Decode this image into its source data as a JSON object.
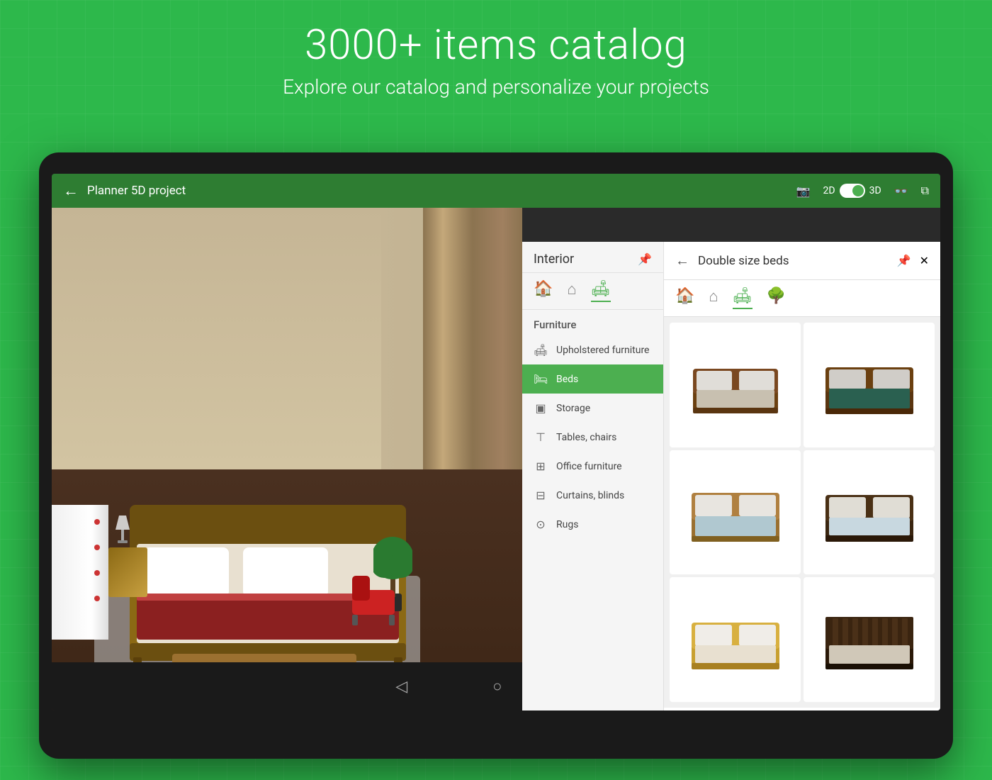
{
  "background_color": "#2db84b",
  "header": {
    "title": "3000+ items catalog",
    "subtitle": "Explore our catalog and personalize your projects"
  },
  "top_bar": {
    "back_label": "←",
    "project_title": "Planner 5D project",
    "view_2d": "2D",
    "view_3d": "3D"
  },
  "interior_panel": {
    "title": "Interior",
    "sections": [
      {
        "label": "Furniture",
        "items": [
          {
            "id": "upholstered",
            "label": "Upholstered furniture",
            "icon": "🛋"
          },
          {
            "id": "beds",
            "label": "Beds",
            "icon": "🛏",
            "active": true
          },
          {
            "id": "storage",
            "label": "Storage",
            "icon": "▣"
          },
          {
            "id": "tables-chairs",
            "label": "Tables, chairs",
            "icon": "⊤"
          },
          {
            "id": "office",
            "label": "Office furniture",
            "icon": "⊞"
          },
          {
            "id": "curtains",
            "label": "Curtains, blinds",
            "icon": "⊟"
          },
          {
            "id": "rugs",
            "label": "Rugs",
            "icon": "⊙"
          }
        ]
      }
    ],
    "tab_icons": [
      "🏠",
      "⌂",
      "🛋"
    ]
  },
  "beds_panel": {
    "title": "Double size\nbeds",
    "back_label": "←",
    "pin_label": "📌",
    "close_label": "✕",
    "tab_icons": [
      "🏠",
      "⌂",
      "🛋",
      "🌳"
    ],
    "beds": [
      {
        "id": "bed1",
        "color_scheme": "brown-white"
      },
      {
        "id": "bed2",
        "color_scheme": "brown-teal"
      },
      {
        "id": "bed3",
        "color_scheme": "light-brown-blue"
      },
      {
        "id": "bed4",
        "color_scheme": "dark-brown-light"
      },
      {
        "id": "bed5",
        "color_scheme": "tan-yellow"
      },
      {
        "id": "bed6",
        "color_scheme": "dark-wood-slats"
      }
    ]
  },
  "bottom_nav": {
    "back_btn": "◁",
    "home_btn": "○",
    "recent_btn": "□"
  }
}
